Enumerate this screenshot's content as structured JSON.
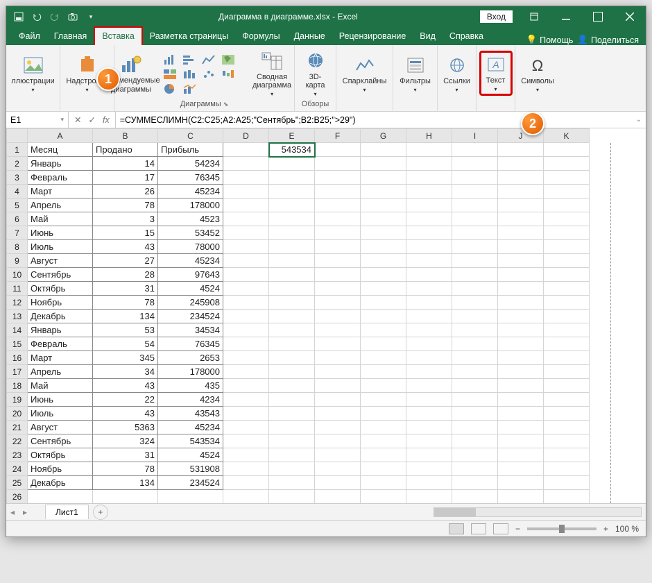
{
  "title": "Диаграмма в диаграмме.xlsx - Excel",
  "titlebar": {
    "login": "Вход"
  },
  "menu": {
    "items": [
      "Файл",
      "Главная",
      "Вставка",
      "Разметка страницы",
      "Формулы",
      "Данные",
      "Рецензирование",
      "Вид",
      "Справка"
    ],
    "help": "Помощь",
    "share": "Поделиться"
  },
  "ribbon": {
    "illustrations": "ллюстрации",
    "addins": "Надстройки",
    "recommended": "Рекомендуемые диаграммы",
    "charts_label": "Диаграммы",
    "pivotchart": "Сводная диаграмма",
    "map3d": "3D-карта",
    "tours_label": "Обзоры",
    "sparklines": "Спарклайны",
    "filters": "Фильтры",
    "links": "Ссылки",
    "text": "Текст",
    "symbols": "Символы"
  },
  "callouts": {
    "c1": "1",
    "c2": "2"
  },
  "formula_bar": {
    "name": "E1",
    "formula": "=СУММЕСЛИМН(C2:C25;A2:A25;\"Сентябрь\";B2:B25;\">29\")"
  },
  "columns": [
    "A",
    "B",
    "C",
    "D",
    "E",
    "F",
    "G",
    "H",
    "I",
    "J",
    "K"
  ],
  "headers": {
    "a": "Месяц",
    "b": "Продано",
    "c": "Прибыль"
  },
  "e1_value": "543534",
  "rows": [
    {
      "n": 1,
      "a": "Месяц",
      "b": "Продано",
      "c": "Прибыль"
    },
    {
      "n": 2,
      "a": "Январь",
      "b": "14",
      "c": "54234"
    },
    {
      "n": 3,
      "a": "Февраль",
      "b": "17",
      "c": "76345"
    },
    {
      "n": 4,
      "a": "Март",
      "b": "26",
      "c": "45234"
    },
    {
      "n": 5,
      "a": "Апрель",
      "b": "78",
      "c": "178000"
    },
    {
      "n": 6,
      "a": "Май",
      "b": "3",
      "c": "4523"
    },
    {
      "n": 7,
      "a": "Июнь",
      "b": "15",
      "c": "53452"
    },
    {
      "n": 8,
      "a": "Июль",
      "b": "43",
      "c": "78000"
    },
    {
      "n": 9,
      "a": "Август",
      "b": "27",
      "c": "45234"
    },
    {
      "n": 10,
      "a": "Сентябрь",
      "b": "28",
      "c": "97643"
    },
    {
      "n": 11,
      "a": "Октябрь",
      "b": "31",
      "c": "4524"
    },
    {
      "n": 12,
      "a": "Ноябрь",
      "b": "78",
      "c": "245908"
    },
    {
      "n": 13,
      "a": "Декабрь",
      "b": "134",
      "c": "234524"
    },
    {
      "n": 14,
      "a": "Январь",
      "b": "53",
      "c": "34534"
    },
    {
      "n": 15,
      "a": "Февраль",
      "b": "54",
      "c": "76345"
    },
    {
      "n": 16,
      "a": "Март",
      "b": "345",
      "c": "2653"
    },
    {
      "n": 17,
      "a": "Апрель",
      "b": "34",
      "c": "178000"
    },
    {
      "n": 18,
      "a": "Май",
      "b": "43",
      "c": "435"
    },
    {
      "n": 19,
      "a": "Июнь",
      "b": "22",
      "c": "4234"
    },
    {
      "n": 20,
      "a": "Июль",
      "b": "43",
      "c": "43543"
    },
    {
      "n": 21,
      "a": "Август",
      "b": "5363",
      "c": "45234"
    },
    {
      "n": 22,
      "a": "Сентябрь",
      "b": "324",
      "c": "543534"
    },
    {
      "n": 23,
      "a": "Октябрь",
      "b": "31",
      "c": "4524"
    },
    {
      "n": 24,
      "a": "Ноябрь",
      "b": "78",
      "c": "531908"
    },
    {
      "n": 25,
      "a": "Декабрь",
      "b": "134",
      "c": "234524"
    }
  ],
  "sheet": {
    "name": "Лист1"
  },
  "status": {
    "zoom": "100 %"
  }
}
